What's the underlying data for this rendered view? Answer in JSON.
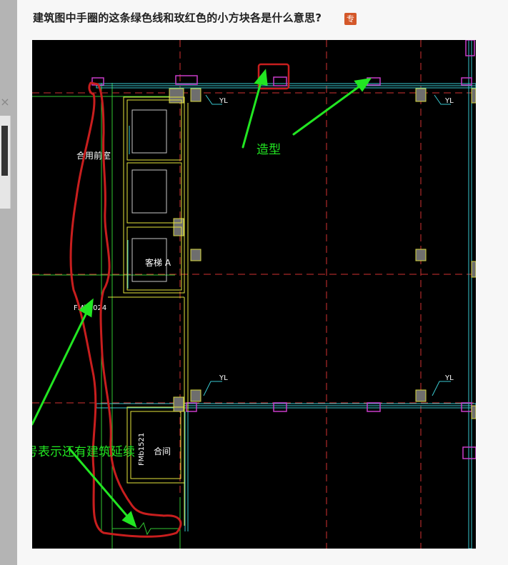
{
  "question": {
    "title": "建筑图中手圈的这条绿色线和玫红色的小方块各是什么意思?",
    "badge": "专"
  },
  "sidebar": {
    "close_glyph": "×"
  },
  "drawing": {
    "labels": {
      "yl": "YL",
      "room_front": "合用前室",
      "elevator": "客梯 A",
      "door_fm1": "FMb1024",
      "door_fm2": "FMb1521",
      "room_small": "合间"
    },
    "annotations": {
      "shape": "造型",
      "break_symbol": "折号表示还有建筑延续"
    },
    "colors": {
      "background": "#000000",
      "wall": "#e6e63c",
      "cyan": "#39c8cf",
      "magenta": "#c83cc8",
      "red_axis": "#d23232",
      "green_line": "#32c832",
      "hand_circle": "#c81e1e",
      "arrow": "#22e622",
      "annotation_text": "#22e622"
    }
  }
}
